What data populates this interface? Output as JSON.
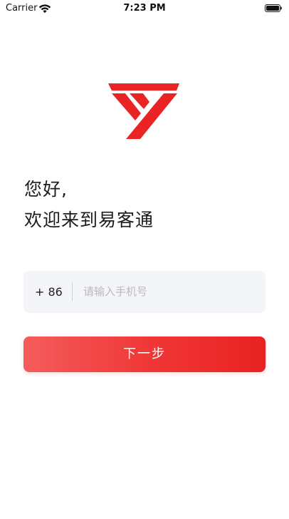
{
  "status_bar": {
    "carrier": "Carrier",
    "time": "7:23 PM",
    "wifi_icon": "wifi-icon",
    "battery_icon": "battery-icon"
  },
  "brand": {
    "logo_icon": "yy-logo-icon",
    "color": "#ea2424"
  },
  "greeting": {
    "line1": "您好,",
    "line2": "欢迎来到易客通"
  },
  "login_form": {
    "country_code": "+ 86",
    "phone_placeholder": "请输入手机号",
    "phone_value": ""
  },
  "next_button": {
    "label": "下一步",
    "color_start": "#f45c5c",
    "color_end": "#e82222"
  }
}
